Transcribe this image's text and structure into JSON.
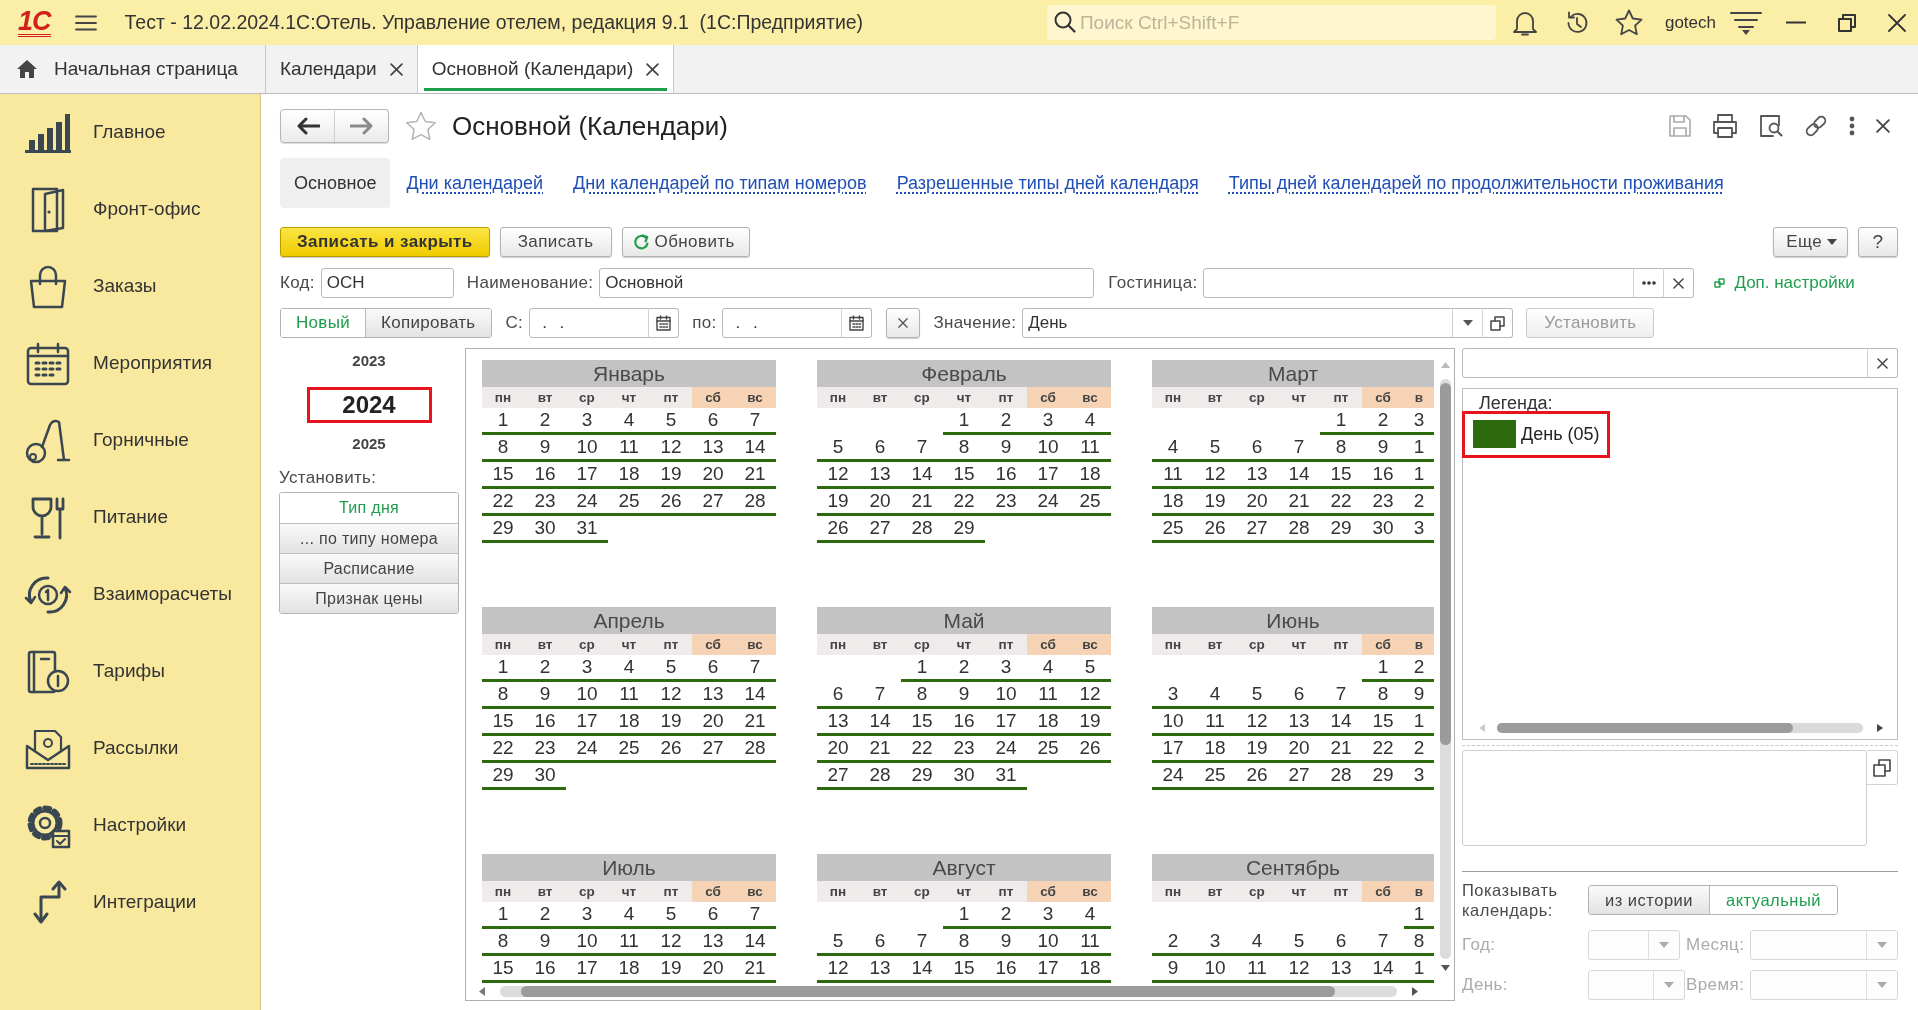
{
  "titlebar": {
    "logo": "1С",
    "title": "Тест - 12.02.2024.1С:Отель. Управление отелем, редакция 9.1  (1С:Предприятие)",
    "search": {
      "placeholder": "Поиск Ctrl+Shift+F"
    },
    "user": "gotech"
  },
  "open_tabs": [
    {
      "label": "Начальная страница",
      "kind": "home",
      "selected": false
    },
    {
      "label": "Календари",
      "kind": "document",
      "selected": false
    },
    {
      "label": "Основной (Календари)",
      "kind": "document",
      "selected": true
    }
  ],
  "sidebar": {
    "items": [
      {
        "label": "Главное"
      },
      {
        "label": "Фронт-офис"
      },
      {
        "label": "Заказы"
      },
      {
        "label": "Мероприятия"
      },
      {
        "label": "Горничные"
      },
      {
        "label": "Питание"
      },
      {
        "label": "Взаиморасчеты"
      },
      {
        "label": "Тарифы"
      },
      {
        "label": "Рассылки"
      },
      {
        "label": "Настройки"
      },
      {
        "label": "Интеграции"
      }
    ]
  },
  "form": {
    "title": "Основной (Календари)",
    "tabs": [
      {
        "label": "Основное",
        "selected": true
      },
      {
        "label": "Дни календарей",
        "selected": false
      },
      {
        "label": "Дни календарей по типам номеров",
        "selected": false
      },
      {
        "label": "Разрешенные типы дней календаря",
        "selected": false
      },
      {
        "label": "Типы дней календарей по продолжительности проживания",
        "selected": false
      }
    ],
    "commands": [
      {
        "label": "Записать и закрыть",
        "kind": "primary"
      },
      {
        "label": "Записать",
        "kind": "plain"
      },
      {
        "label": "Обновить",
        "kind": "refresh"
      }
    ],
    "more_button": "Еще",
    "help_button": "?",
    "code": {
      "label": "Код:",
      "value": "ОСН"
    },
    "name": {
      "label": "Наименование:",
      "value": "Основной"
    },
    "hotel": {
      "label": "Гостиница:"
    },
    "settings_link": "Доп. настройки",
    "mode": [
      {
        "label": "Новый",
        "selected": true
      },
      {
        "label": "Копировать",
        "selected": false
      }
    ],
    "date_from": {
      "label": "С:",
      "value": ". ."
    },
    "date_to": {
      "label": "по:",
      "value": ". ."
    },
    "value": {
      "label": "Значение:",
      "value": "День"
    },
    "apply_button": {
      "label": "Установить",
      "disabled": true
    }
  },
  "years": [
    {
      "label": "2023",
      "selected": false
    },
    {
      "label": "2024",
      "selected": true
    },
    {
      "label": "2025",
      "selected": false
    }
  ],
  "set_label": "Установить:",
  "set_modes": [
    {
      "label": "Тип дня",
      "selected": true
    },
    {
      "label": "... по типу номера",
      "selected": false
    },
    {
      "label": "Расписание",
      "selected": false
    },
    {
      "label": "Признак цены",
      "selected": false
    }
  ],
  "calendar": {
    "months": [
      {
        "name": "Январь",
        "weekdays": [
          {
            "label": "пн",
            "weekend": false
          },
          {
            "label": "вт",
            "weekend": false
          },
          {
            "label": "ср",
            "weekend": false
          },
          {
            "label": "чт",
            "weekend": false
          },
          {
            "label": "пт",
            "weekend": false
          },
          {
            "label": "сб",
            "weekend": true
          },
          {
            "label": "вс",
            "weekend": true
          }
        ],
        "weeks": [
          [
            "1",
            "2",
            "3",
            "4",
            "5",
            "6",
            "7"
          ],
          [
            "8",
            "9",
            "10",
            "11",
            "12",
            "13",
            "14"
          ],
          [
            "15",
            "16",
            "17",
            "18",
            "19",
            "20",
            "21"
          ],
          [
            "22",
            "23",
            "24",
            "25",
            "26",
            "27",
            "28"
          ],
          [
            "29",
            "30",
            "31"
          ]
        ]
      },
      {
        "name": "Февраль",
        "weekdays": [
          {
            "label": "пн",
            "weekend": false
          },
          {
            "label": "вт",
            "weekend": false
          },
          {
            "label": "ср",
            "weekend": false
          },
          {
            "label": "чт",
            "weekend": false
          },
          {
            "label": "пт",
            "weekend": false
          },
          {
            "label": "сб",
            "weekend": true
          },
          {
            "label": "вс",
            "weekend": true
          }
        ],
        "weeks": [
          [
            "1",
            "2",
            "3",
            "4"
          ],
          [
            "5",
            "6",
            "7",
            "8",
            "9",
            "10",
            "11"
          ],
          [
            "12",
            "13",
            "14",
            "15",
            "16",
            "17",
            "18"
          ],
          [
            "19",
            "20",
            "21",
            "22",
            "23",
            "24",
            "25"
          ],
          [
            "26",
            "27",
            "28",
            "29"
          ]
        ]
      },
      {
        "name": "Март",
        "weekdays": [
          {
            "label": "пн",
            "weekend": false
          },
          {
            "label": "вт",
            "weekend": false
          },
          {
            "label": "ср",
            "weekend": false
          },
          {
            "label": "чт",
            "weekend": false
          },
          {
            "label": "пт",
            "weekend": false
          },
          {
            "label": "сб",
            "weekend": true
          },
          {
            "label": "в",
            "weekend": true
          }
        ],
        "weeks": [
          [
            "1",
            "2",
            "3"
          ],
          [
            "4",
            "5",
            "6",
            "7",
            "8",
            "9",
            "1"
          ],
          [
            "11",
            "12",
            "13",
            "14",
            "15",
            "16",
            "1"
          ],
          [
            "18",
            "19",
            "20",
            "21",
            "22",
            "23",
            "2"
          ],
          [
            "25",
            "26",
            "27",
            "28",
            "29",
            "30",
            "3"
          ]
        ]
      },
      {
        "name": "Апрель",
        "weekdays": [
          {
            "label": "пн",
            "weekend": false
          },
          {
            "label": "вт",
            "weekend": false
          },
          {
            "label": "ср",
            "weekend": false
          },
          {
            "label": "чт",
            "weekend": false
          },
          {
            "label": "пт",
            "weekend": false
          },
          {
            "label": "сб",
            "weekend": true
          },
          {
            "label": "вс",
            "weekend": true
          }
        ],
        "weeks": [
          [
            "1",
            "2",
            "3",
            "4",
            "5",
            "6",
            "7"
          ],
          [
            "8",
            "9",
            "10",
            "11",
            "12",
            "13",
            "14"
          ],
          [
            "15",
            "16",
            "17",
            "18",
            "19",
            "20",
            "21"
          ],
          [
            "22",
            "23",
            "24",
            "25",
            "26",
            "27",
            "28"
          ],
          [
            "29",
            "30"
          ]
        ]
      },
      {
        "name": "Май",
        "weekdays": [
          {
            "label": "пн",
            "weekend": false
          },
          {
            "label": "вт",
            "weekend": false
          },
          {
            "label": "ср",
            "weekend": false
          },
          {
            "label": "чт",
            "weekend": false
          },
          {
            "label": "пт",
            "weekend": false
          },
          {
            "label": "сб",
            "weekend": true
          },
          {
            "label": "вс",
            "weekend": true
          }
        ],
        "weeks": [
          [
            "1",
            "2",
            "3",
            "4",
            "5"
          ],
          [
            "6",
            "7",
            "8",
            "9",
            "10",
            "11",
            "12"
          ],
          [
            "13",
            "14",
            "15",
            "16",
            "17",
            "18",
            "19"
          ],
          [
            "20",
            "21",
            "22",
            "23",
            "24",
            "25",
            "26"
          ],
          [
            "27",
            "28",
            "29",
            "30",
            "31"
          ]
        ]
      },
      {
        "name": "Июнь",
        "weekdays": [
          {
            "label": "пн",
            "weekend": false
          },
          {
            "label": "вт",
            "weekend": false
          },
          {
            "label": "ср",
            "weekend": false
          },
          {
            "label": "чт",
            "weekend": false
          },
          {
            "label": "пт",
            "weekend": false
          },
          {
            "label": "сб",
            "weekend": true
          },
          {
            "label": "в",
            "weekend": true
          }
        ],
        "weeks": [
          [
            "1",
            "2"
          ],
          [
            "3",
            "4",
            "5",
            "6",
            "7",
            "8",
            "9"
          ],
          [
            "10",
            "11",
            "12",
            "13",
            "14",
            "15",
            "1"
          ],
          [
            "17",
            "18",
            "19",
            "20",
            "21",
            "22",
            "2"
          ],
          [
            "24",
            "25",
            "26",
            "27",
            "28",
            "29",
            "3"
          ]
        ]
      },
      {
        "name": "Июль",
        "weekdays": [
          {
            "label": "пн",
            "weekend": false
          },
          {
            "label": "вт",
            "weekend": false
          },
          {
            "label": "ср",
            "weekend": false
          },
          {
            "label": "чт",
            "weekend": false
          },
          {
            "label": "пт",
            "weekend": false
          },
          {
            "label": "сб",
            "weekend": true
          },
          {
            "label": "вс",
            "weekend": true
          }
        ],
        "weeks": [
          [
            "1",
            "2",
            "3",
            "4",
            "5",
            "6",
            "7"
          ],
          [
            "8",
            "9",
            "10",
            "11",
            "12",
            "13",
            "14"
          ],
          [
            "15",
            "16",
            "17",
            "18",
            "19",
            "20",
            "21"
          ]
        ]
      },
      {
        "name": "Август",
        "weekdays": [
          {
            "label": "пн",
            "weekend": false
          },
          {
            "label": "вт",
            "weekend": false
          },
          {
            "label": "ср",
            "weekend": false
          },
          {
            "label": "чт",
            "weekend": false
          },
          {
            "label": "пт",
            "weekend": false
          },
          {
            "label": "сб",
            "weekend": true
          },
          {
            "label": "вс",
            "weekend": true
          }
        ],
        "weeks": [
          [
            "1",
            "2",
            "3",
            "4"
          ],
          [
            "5",
            "6",
            "7",
            "8",
            "9",
            "10",
            "11"
          ],
          [
            "12",
            "13",
            "14",
            "15",
            "16",
            "17",
            "18"
          ]
        ]
      },
      {
        "name": "Сентябрь",
        "weekdays": [
          {
            "label": "пн",
            "weekend": false
          },
          {
            "label": "вт",
            "weekend": false
          },
          {
            "label": "ср",
            "weekend": false
          },
          {
            "label": "чт",
            "weekend": false
          },
          {
            "label": "пт",
            "weekend": false
          },
          {
            "label": "сб",
            "weekend": true
          },
          {
            "label": "в",
            "weekend": true
          }
        ],
        "weeks": [
          [
            "1"
          ],
          [
            "2",
            "3",
            "4",
            "5",
            "6",
            "7",
            "8"
          ],
          [
            "9",
            "10",
            "11",
            "12",
            "13",
            "14",
            "1"
          ]
        ]
      }
    ]
  },
  "legend": {
    "title": "Легенда:",
    "items": [
      {
        "label": "День (05)",
        "color": "#2d6a0e",
        "highlighted": true
      }
    ]
  },
  "history": {
    "label": "Показывать календарь:",
    "options": [
      {
        "label": "из истории",
        "selected": false
      },
      {
        "label": "актуальный",
        "selected": true
      }
    ],
    "filters": [
      {
        "label": "Год:",
        "disabled": true
      },
      {
        "label": "Месяц:",
        "disabled": true
      },
      {
        "label": "День:",
        "disabled": true
      },
      {
        "label": "Время:",
        "disabled": true
      }
    ]
  }
}
